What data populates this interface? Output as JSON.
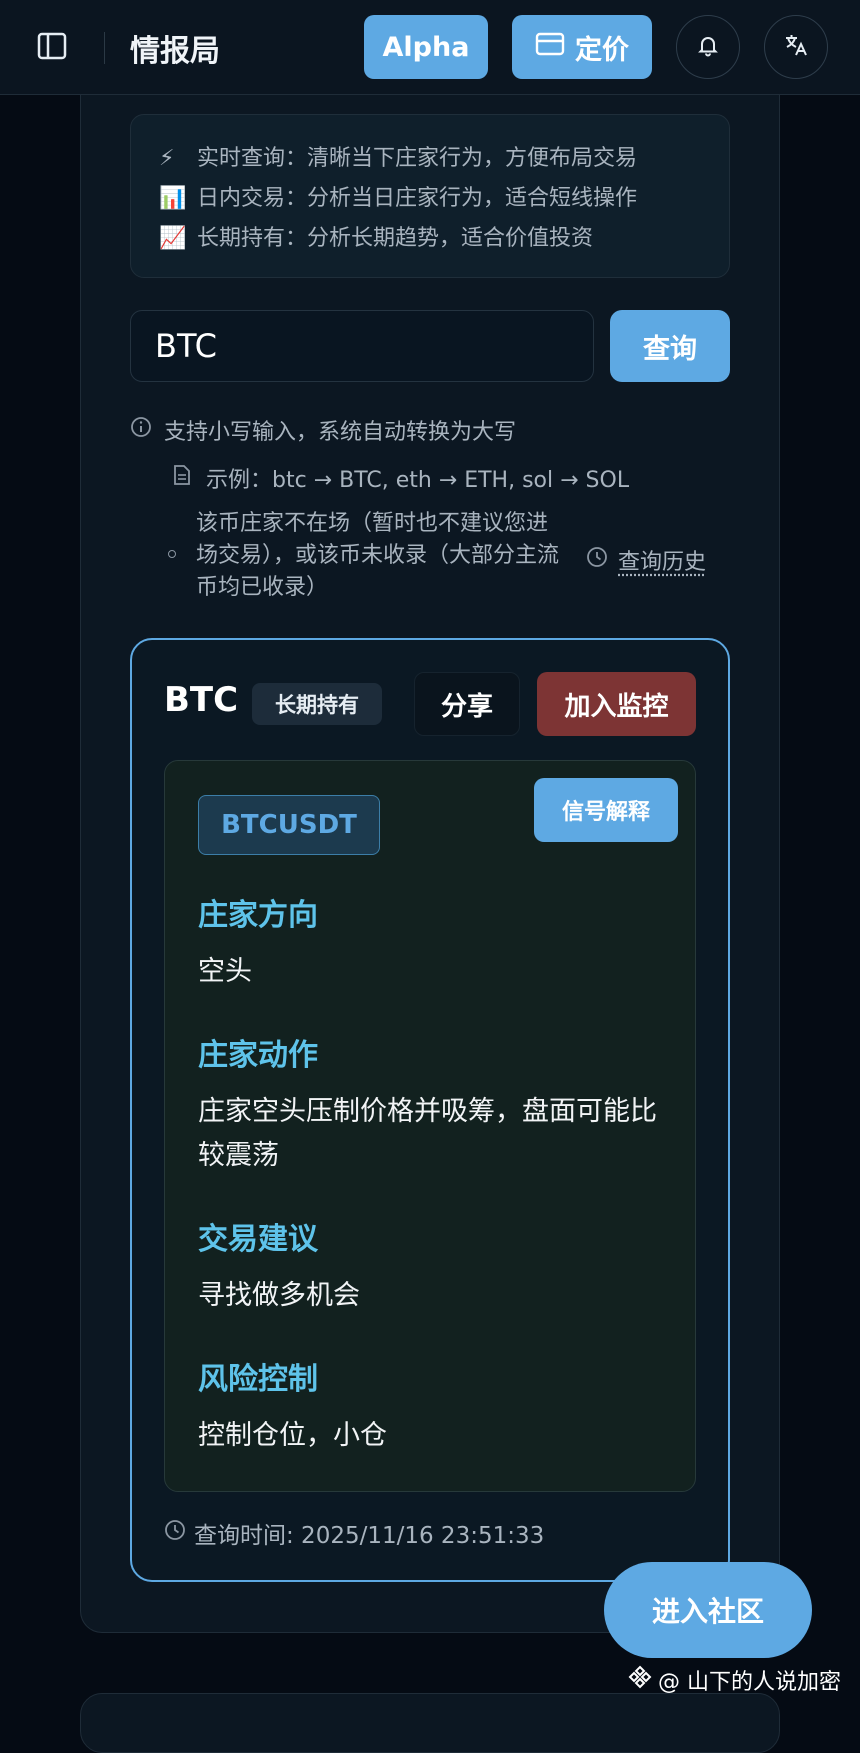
{
  "header": {
    "title": "情报局",
    "alpha_label": "Alpha",
    "pricing_label": "定价"
  },
  "info": {
    "lines": [
      {
        "icon": "⚡",
        "text": "实时查询：清晰当下庄家行为，方便布局交易"
      },
      {
        "icon": "📊",
        "text": "日内交易：分析当日庄家行为，适合短线操作"
      },
      {
        "icon": "📈",
        "text": "长期持有：分析长期趋势，适合价值投资"
      }
    ]
  },
  "search": {
    "value": "BTC",
    "button_label": "查询",
    "hint_case": "支持小写输入，系统自动转换为大写",
    "hint_example": "示例：btc → BTC, eth → ETH, sol → SOL",
    "note": "该币庄家不在场（暂时也不建议您进场交易），或该币未收录（大部分主流币均已收录）",
    "history_label": "查询历史"
  },
  "result": {
    "symbol": "BTC",
    "mode_badge": "长期持有",
    "share_label": "分享",
    "monitor_label": "加入监控",
    "pair": "BTCUSDT",
    "explain_label": "信号解释",
    "sections": [
      {
        "title": "庄家方向",
        "value": "空头"
      },
      {
        "title": "庄家动作",
        "value": "庄家空头压制价格并吸筹，盘面可能比较震荡"
      },
      {
        "title": "交易建议",
        "value": "寻找做多机会"
      },
      {
        "title": "风险控制",
        "value": "控制仓位，小仓"
      }
    ],
    "query_time": "查询时间: 2025/11/16 23:51:33"
  },
  "community_label": "进入社区",
  "watermark": "@ 山下的人说加密",
  "colors": {
    "accent": "#5ea9e3",
    "danger": "#7d3434",
    "section_title": "#5ec3ea",
    "background": "#050b14"
  }
}
